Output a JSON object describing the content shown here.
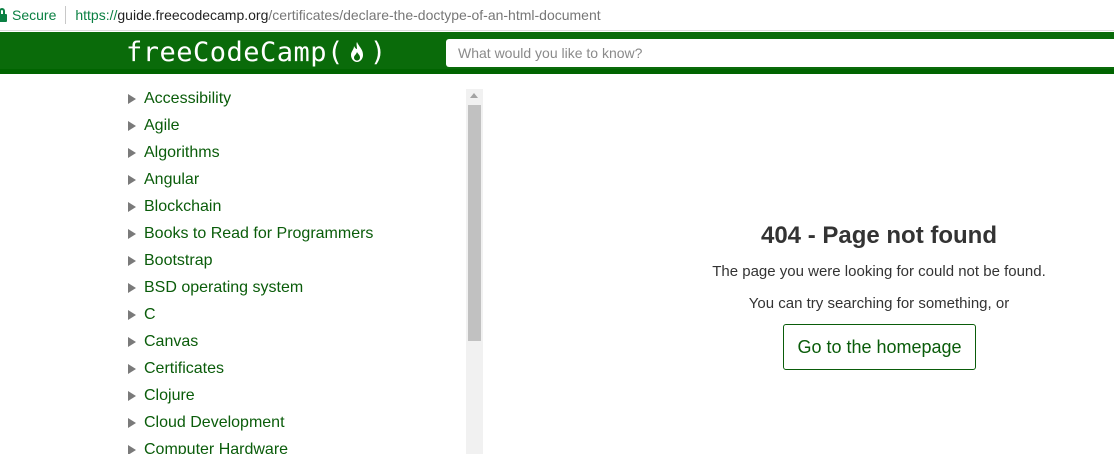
{
  "browser": {
    "secure_label": "Secure",
    "url_scheme": "https://",
    "url_host": "guide.freecodecamp.org",
    "url_path": "/certificates/declare-the-doctype-of-an-html-document"
  },
  "header": {
    "logo_text_left": "freeCodeCamp(",
    "logo_text_right": ")",
    "search_placeholder": "What would you like to know?",
    "colors": {
      "header_bg": "#006400",
      "link": "#0a5c0a"
    }
  },
  "sidebar": {
    "items": [
      {
        "label": "Accessibility"
      },
      {
        "label": "Agile"
      },
      {
        "label": "Algorithms"
      },
      {
        "label": "Angular"
      },
      {
        "label": "Blockchain"
      },
      {
        "label": "Books to Read for Programmers"
      },
      {
        "label": "Bootstrap"
      },
      {
        "label": "BSD operating system"
      },
      {
        "label": "C"
      },
      {
        "label": "Canvas"
      },
      {
        "label": "Certificates"
      },
      {
        "label": "Clojure"
      },
      {
        "label": "Cloud Development"
      },
      {
        "label": "Computer Hardware"
      }
    ]
  },
  "main": {
    "title": "404 - Page not found",
    "message": "The page you were looking for could not be found.",
    "suggestion": "You can try searching for something, or",
    "home_button": "Go to the homepage"
  }
}
